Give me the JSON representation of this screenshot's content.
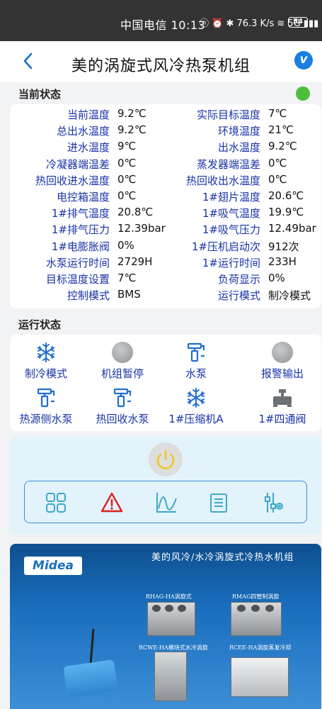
{
  "statusbar": {
    "carrier_time": "中国电信 10:13",
    "icons": "ⓝ ⏰ ✱ 76.3 K/s ≋ 5G ▮▮▮",
    "battery": "54"
  },
  "header": {
    "back_icon": "chevron-left-icon",
    "title": "美的涡旋式风冷热泵机组",
    "logo": "v"
  },
  "current_status": {
    "label": "当前状态",
    "online_color": "#4cbf3a",
    "rows": [
      {
        "k1": "当前温度",
        "v1": "9.2℃",
        "k2": "实际目标温度",
        "v2": "7℃"
      },
      {
        "k1": "总出水温度",
        "v1": "9.2℃",
        "k2": "环境温度",
        "v2": "21℃"
      },
      {
        "k1": "进水温度",
        "v1": "9℃",
        "k2": "出水温度",
        "v2": "9.2℃"
      },
      {
        "k1": "冷凝器端温差",
        "v1": "0℃",
        "k2": "蒸发器端温差",
        "v2": "0℃"
      },
      {
        "k1": "热回收进水温度",
        "v1": "0℃",
        "k2": "热回收出水温度",
        "v2": "0℃"
      },
      {
        "k1": "电控箱温度",
        "v1": "0℃",
        "k2": "1#翅片温度",
        "v2": "20.6℃"
      },
      {
        "k1": "1#排气温度",
        "v1": "20.8℃",
        "k2": "1#吸气温度",
        "v2": "19.9℃"
      },
      {
        "k1": "1#排气压力",
        "v1": "12.39bar",
        "k2": "1#吸气压力",
        "v2": "12.49bar"
      },
      {
        "k1": "1#电膨胀阀",
        "v1": "0%",
        "k2": "1#压机启动次",
        "v2": "912次"
      },
      {
        "k1": "水泵运行时间",
        "v1": "2729H",
        "k2": "1#运行时间",
        "v2": "233H"
      },
      {
        "k1": "目标温度设置",
        "v1": "7℃",
        "k2": "负荷显示",
        "v2": "0%"
      },
      {
        "k1": "控制模式",
        "v1": "BMS",
        "k2": "运行模式",
        "v2": "制冷模式"
      }
    ]
  },
  "run_status": {
    "label": "运行状态",
    "items": [
      {
        "label": "制冷模式",
        "icon": "snowflake-icon"
      },
      {
        "label": "机组暂停",
        "icon": "grey-indicator-icon"
      },
      {
        "label": "水泵",
        "icon": "pump-icon"
      },
      {
        "label": "报警输出",
        "icon": "grey-indicator-icon"
      },
      {
        "label": "热源侧水泵",
        "icon": "pump-icon"
      },
      {
        "label": "热回收水泵",
        "icon": "pump-icon"
      },
      {
        "label": "1#压缩机A",
        "icon": "snowflake-icon"
      },
      {
        "label": "1#四通阀",
        "icon": "valve-icon"
      }
    ]
  },
  "controls": {
    "power_icon": "power-icon",
    "toolbar": [
      "grid-icon",
      "warning-icon",
      "chart-icon",
      "list-icon",
      "sliders-icon"
    ]
  },
  "banner": {
    "title": "美的风冷/水冷涡旋式冷热水机组",
    "brand": "Midea",
    "products": [
      "RHAG-HA涡旋式",
      "RMAG四管制涡旋",
      "RCWE-HA模块式水冷涡旋",
      "RCEE-HA涡旋蒸发冷却"
    ]
  }
}
